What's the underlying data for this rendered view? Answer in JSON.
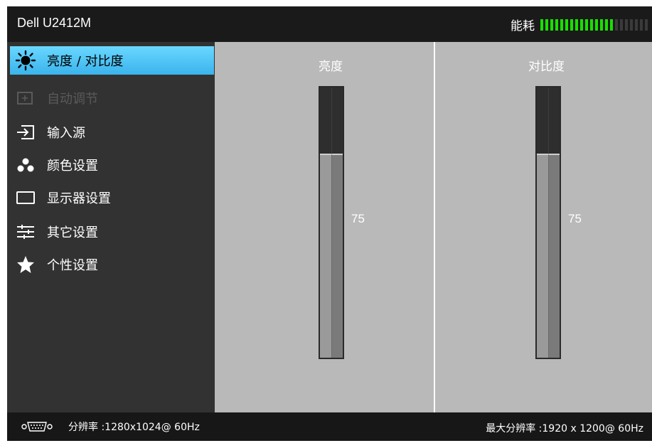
{
  "header": {
    "model": "Dell U2412M",
    "energy_label": "能耗",
    "energy_level": 0.7,
    "energy_active_color": "#18e000",
    "energy_inactive_color": "#3a3a3a"
  },
  "menu": {
    "items": [
      {
        "label": "亮度 / 对比度",
        "icon": "brightness-sun-icon",
        "selected": true
      },
      {
        "label": "自动调节",
        "icon": "auto-adjust-icon",
        "disabled": true
      },
      {
        "label": "输入源",
        "icon": "input-source-icon"
      },
      {
        "label": "颜色设置",
        "icon": "color-dots-icon"
      },
      {
        "label": "显示器设置",
        "icon": "display-rectangle-icon"
      },
      {
        "label": "其它设置",
        "icon": "sliders-icon"
      },
      {
        "label": "个性设置",
        "icon": "star-icon"
      }
    ],
    "selected_color": "#3ab3ec"
  },
  "brightness": {
    "title": "亮度",
    "value": "75",
    "level": 0.75
  },
  "contrast": {
    "title": "对比度",
    "value": "75",
    "level": 0.75
  },
  "footer": {
    "resolution": "分辨率 :1280x1024@ 60Hz",
    "max_resolution": "最大分辨率 :1920 x 1200@ 60Hz",
    "connector_icon": "vga-connector-icon"
  }
}
